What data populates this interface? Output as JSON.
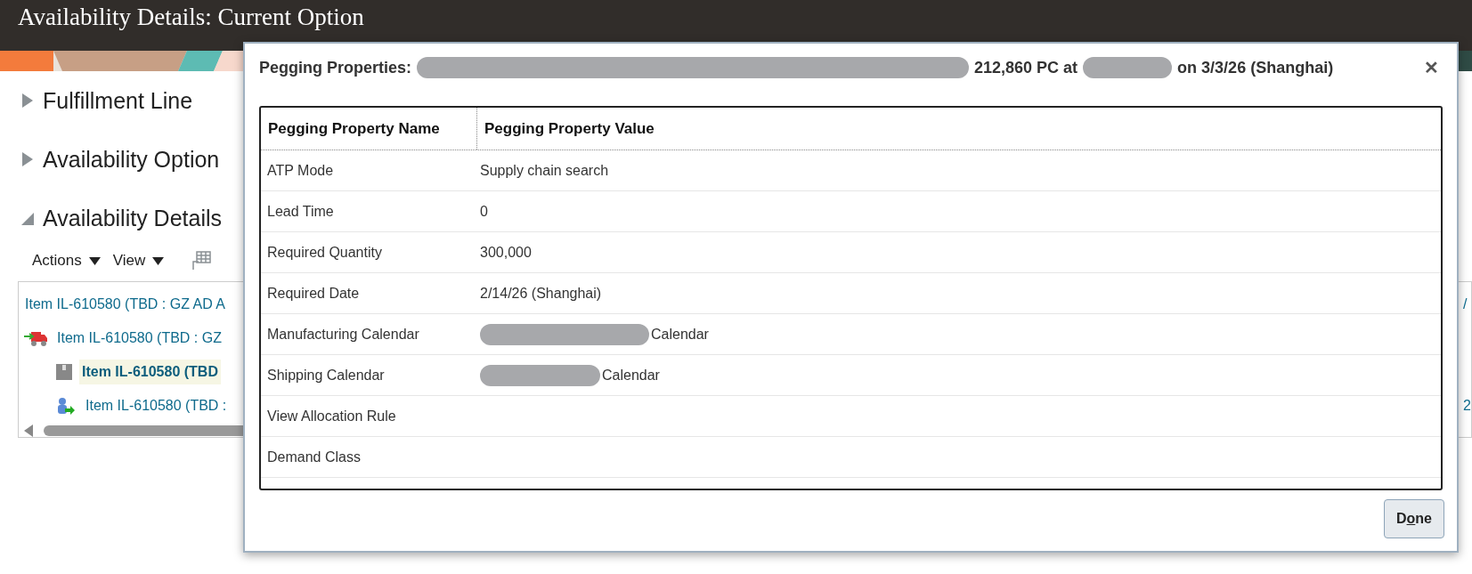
{
  "page": {
    "title": "Availability Details: Current Option"
  },
  "sections": [
    {
      "label": "Fulfillment Line",
      "expanded": false
    },
    {
      "label": "Availability Option",
      "expanded": false
    },
    {
      "label": "Availability Details",
      "expanded": true
    }
  ],
  "toolbar": {
    "menus": [
      "Actions",
      "View"
    ]
  },
  "tree": {
    "rows": [
      {
        "text": "Item IL-610580 (TBD : GZ AD A",
        "tail": "/",
        "selected": false,
        "children": [
          {
            "text": "Item IL-610580 (TBD : GZ",
            "kind": "truck",
            "selected": false,
            "children": [
              {
                "text": "Item IL-610580 (TBD",
                "kind": "box",
                "selected": true
              },
              {
                "text": "Item IL-610580 (TBD :",
                "kind": "person",
                "tail": "2",
                "selected": false
              }
            ]
          }
        ]
      }
    ]
  },
  "dialog": {
    "title_parts": [
      {
        "kind": "text",
        "text": "Pegging Properties:"
      },
      {
        "kind": "redacted"
      },
      {
        "kind": "text",
        "text": "212,860 PC at"
      },
      {
        "kind": "redacted"
      },
      {
        "kind": "text",
        "text": "on 3/3/26 (Shanghai)"
      }
    ],
    "close": "✕",
    "table": {
      "columns": [
        "Pegging Property Name",
        "Pegging Property Value"
      ],
      "rows": [
        {
          "name": "ATP Mode",
          "value": [
            {
              "kind": "text",
              "text": "Supply chain search"
            }
          ]
        },
        {
          "name": "Lead Time",
          "value": [
            {
              "kind": "text",
              "text": "0"
            }
          ]
        },
        {
          "name": "Required Quantity",
          "value": [
            {
              "kind": "text",
              "text": "300,000"
            }
          ]
        },
        {
          "name": "Required Date",
          "value": [
            {
              "kind": "text",
              "text": "2/14/26 (Shanghai)"
            }
          ]
        },
        {
          "name": "Manufacturing Calendar",
          "value": [
            {
              "kind": "redacted"
            },
            {
              "kind": "text",
              "text": "Calendar"
            }
          ]
        },
        {
          "name": "Shipping Calendar",
          "value": [
            {
              "kind": "redacted"
            },
            {
              "kind": "text",
              "text": "Calendar"
            }
          ]
        },
        {
          "name": "View Allocation Rule",
          "value": []
        },
        {
          "name": "Demand Class",
          "value": []
        }
      ]
    },
    "button": {
      "label_parts": [
        {
          "text": "D",
          "underlined": false
        },
        {
          "text": "o",
          "underlined": true
        },
        {
          "text": "ne",
          "underlined": false
        }
      ]
    }
  }
}
